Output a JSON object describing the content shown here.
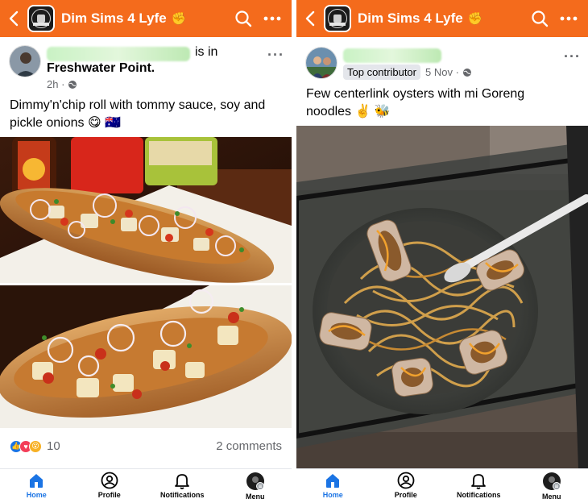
{
  "colors": {
    "header": "#f46b1c",
    "link_blue": "#1b74e4",
    "secondary_text": "#65676b"
  },
  "left": {
    "header": {
      "group_name": "Dim Sims 4 Lyfe",
      "badge_emoji": "✊",
      "back_icon": "chevron-left-icon",
      "search_icon": "search-icon",
      "more_icon": "more-horizontal-icon"
    },
    "logo": {
      "top_text": "SIMS 4 LY",
      "bottom_text": "EST. 2018"
    },
    "post": {
      "action_text": "is in",
      "location": "Freshwater Point.",
      "time": "2h ·",
      "body": "Dimmy'n'chip roll with tommy sauce, soy and pickle onions 😋 🇦🇺",
      "reaction_count": "10",
      "comments": "2 comments"
    },
    "nav": [
      {
        "label": "Home",
        "icon": "home-icon"
      },
      {
        "label": "Profile",
        "icon": "profile-icon"
      },
      {
        "label": "Notifications",
        "icon": "bell-icon"
      },
      {
        "label": "Menu",
        "icon": "menu-avatar-icon"
      }
    ]
  },
  "right": {
    "header": {
      "group_name": "Dim Sims 4 Lyfe",
      "badge_emoji": "✊"
    },
    "logo": {
      "top_text": "SIMS 4 LY",
      "bottom_text": "EST. 2018"
    },
    "post": {
      "badge": "Top contributor",
      "time": "5 Nov ·",
      "body": "Few centerlink oysters with mi Goreng noodles ✌️ 🐝"
    },
    "nav": [
      {
        "label": "Home",
        "icon": "home-icon"
      },
      {
        "label": "Profile",
        "icon": "profile-icon"
      },
      {
        "label": "Notifications",
        "icon": "bell-icon"
      },
      {
        "label": "Menu",
        "icon": "menu-avatar-icon"
      }
    ]
  }
}
